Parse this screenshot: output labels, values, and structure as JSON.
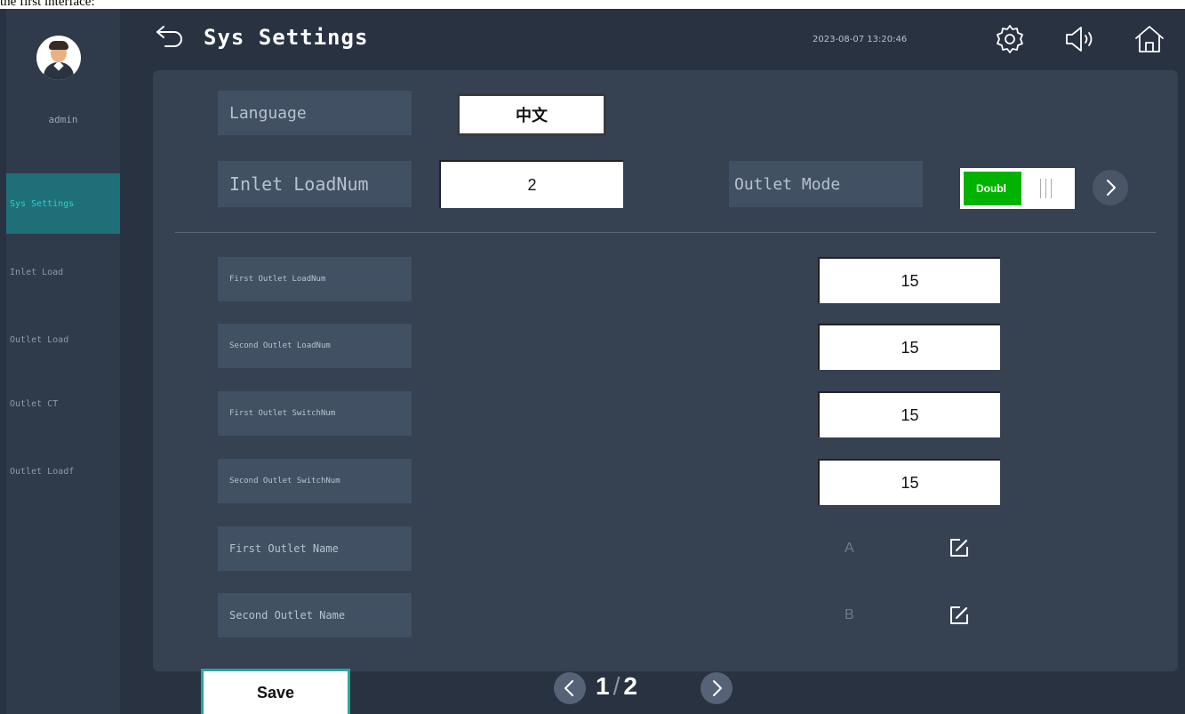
{
  "caption": "the first interface:",
  "user": {
    "name": "admin"
  },
  "sidebar": {
    "items": [
      {
        "label": "Sys Settings",
        "active": true
      },
      {
        "label": "Inlet Load",
        "active": false
      },
      {
        "label": "Outlet Load",
        "active": false
      },
      {
        "label": "Outlet CT",
        "active": false
      },
      {
        "label": "Outlet Loadf",
        "active": false
      }
    ]
  },
  "header": {
    "title": "Sys Settings",
    "datetime": "2023-08-07 13:20:46",
    "icons": [
      "back-arrow-icon",
      "gear-icon",
      "speaker-icon",
      "home-icon"
    ]
  },
  "settings": {
    "language_label": "Language",
    "language_value": "中文",
    "inlet_loadnum_label": "Inlet LoadNum",
    "inlet_loadnum_value": "2",
    "outlet_mode_label": "Outlet Mode",
    "outlet_mode_value": "Doubl",
    "outlet_mode_on": true,
    "rows": [
      {
        "label": "First Outlet LoadNum",
        "value": "15"
      },
      {
        "label": "Second Outlet LoadNum",
        "value": "15"
      },
      {
        "label": "First Outlet SwitchNum",
        "value": "15"
      },
      {
        "label": "Second Outlet SwitchNum",
        "value": "15"
      }
    ],
    "names": [
      {
        "label": "First Outlet Name",
        "value": "A"
      },
      {
        "label": "Second Outlet Name",
        "value": "B"
      }
    ]
  },
  "footer": {
    "save_label": "Save",
    "page_current": "1",
    "page_sep": "/",
    "page_total": "2"
  },
  "colors": {
    "background": "#283241",
    "panel": "#364152",
    "accent": "#2fd0c8",
    "toggle_on": "#00b300"
  }
}
